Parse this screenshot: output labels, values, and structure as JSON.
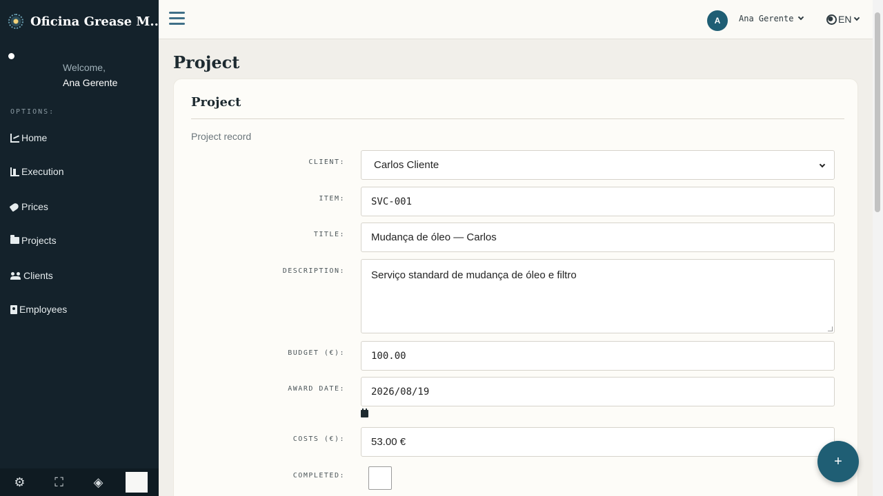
{
  "app": {
    "name": "Oficina Grease M..."
  },
  "sidebar": {
    "welcome": "Welcome,",
    "user_name": "Ana Gerente",
    "options_label": "OPTIONS:",
    "items": [
      {
        "label": "Home",
        "icon": "chart-line-icon"
      },
      {
        "label": "Execution",
        "icon": "execution-icon"
      },
      {
        "label": "Prices",
        "icon": "tags-icon"
      },
      {
        "label": "Projects",
        "icon": "folder-open-icon"
      },
      {
        "label": "Clients",
        "icon": "users-icon"
      },
      {
        "label": "Employees",
        "icon": "id-badge-icon"
      }
    ],
    "footer": [
      "gear-icon",
      "fullscreen-icon",
      "eye-slash-icon"
    ]
  },
  "topbar": {
    "avatar_initial": "A",
    "user_name": "Ana Gerente",
    "language": "EN"
  },
  "page": {
    "title": "Project",
    "card_title": "Project",
    "card_subtitle": "Project record"
  },
  "form": {
    "client": {
      "label": "CLIENT:",
      "value": "Carlos Cliente"
    },
    "item": {
      "label": "ITEM:",
      "value": "SVC-001"
    },
    "title": {
      "label": "TITLE:",
      "value": "Mudança de óleo — Carlos"
    },
    "description": {
      "label": "DESCRIPTION:",
      "value": "Serviço standard de mudança de óleo e filtro"
    },
    "budget": {
      "label": "BUDGET (€):",
      "value": "100.00"
    },
    "award_date": {
      "label": "AWARD DATE:",
      "value": "2026/08/19"
    },
    "costs": {
      "label": "COSTS (€):",
      "value": "53.00 €"
    },
    "completed": {
      "label": "COMPLETED:",
      "checked": false
    }
  },
  "fab_label": "+",
  "colors": {
    "sidebar": "#14222b",
    "accent": "#1f5e74",
    "background": "#f1efea"
  }
}
